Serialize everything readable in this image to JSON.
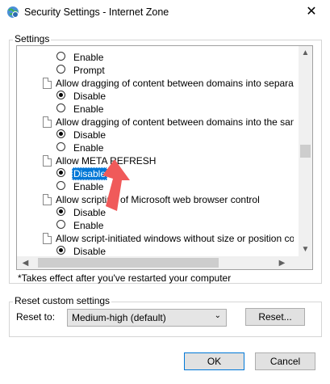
{
  "window": {
    "title": "Security Settings - Internet Zone",
    "close_glyph": "✕"
  },
  "settings_group": {
    "label": "Settings"
  },
  "list": {
    "rows": [
      {
        "kind": "option",
        "label": "Enable",
        "checked": false
      },
      {
        "kind": "option",
        "label": "Prompt",
        "checked": false
      },
      {
        "kind": "setting",
        "label": "Allow dragging of content between domains into separate wi"
      },
      {
        "kind": "option",
        "label": "Disable",
        "checked": true
      },
      {
        "kind": "option",
        "label": "Enable",
        "checked": false
      },
      {
        "kind": "setting",
        "label": "Allow dragging of content between domains into the same wi"
      },
      {
        "kind": "option",
        "label": "Disable",
        "checked": true
      },
      {
        "kind": "option",
        "label": "Enable",
        "checked": false
      },
      {
        "kind": "setting",
        "label": "Allow META REFRESH"
      },
      {
        "kind": "option",
        "label": "Disable",
        "checked": true,
        "selected": true
      },
      {
        "kind": "option",
        "label": "Enable",
        "checked": false
      },
      {
        "kind": "setting",
        "label": "Allow scripting of Microsoft web browser control"
      },
      {
        "kind": "option",
        "label": "Disable",
        "checked": true
      },
      {
        "kind": "option",
        "label": "Enable",
        "checked": false
      },
      {
        "kind": "setting",
        "label": "Allow script-initiated windows without size or position constra"
      },
      {
        "kind": "option",
        "label": "Disable",
        "checked": true
      }
    ],
    "scroll_up": "▲",
    "scroll_down": "▼",
    "scroll_left": "◀",
    "scroll_right": "▶",
    "vertical_scroll_position": 0.55
  },
  "footnote": "*Takes effect after you've restarted your computer",
  "reset_group": {
    "label": "Reset custom settings",
    "reset_to_label": "Reset to:",
    "select_value": "Medium-high (default)",
    "select_chevron": "⌄",
    "reset_button": "Reset..."
  },
  "buttons": {
    "ok": "OK",
    "cancel": "Cancel"
  },
  "colors": {
    "selection": "#0078d7",
    "annotation_arrow": "#f05a5a"
  }
}
